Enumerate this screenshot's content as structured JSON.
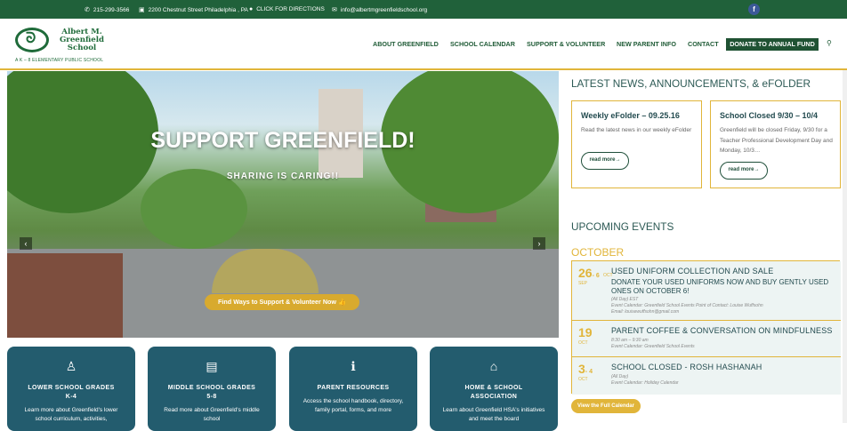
{
  "topbar": {
    "phone": "215-299-3566",
    "address": "2200 Chestnut Street Philadelphia , PA",
    "directions": "CLICK FOR DIRECTIONS",
    "email": "info@albertmgreenfieldschool.org",
    "facebook": "f"
  },
  "logo": {
    "name_line1": "Albert M.",
    "name_line2": "Greenfield",
    "name_line3": "School",
    "tagline": "A K – 8 ELEMENTARY PUBLIC SCHOOL"
  },
  "nav": {
    "items": [
      "ABOUT GREENFIELD",
      "SCHOOL CALENDAR",
      "SUPPORT & VOLUNTEER",
      "NEW PARENT INFO",
      "CONTACT"
    ],
    "donate": "DONATE TO ANNUAL FUND"
  },
  "hero": {
    "title": "SUPPORT GREENFIELD!",
    "subtitle": "SHARING IS CARING!!",
    "button": "Find Ways to Support & Volunteer Now"
  },
  "cards": [
    {
      "title_1": "LOWER SCHOOL GRADES",
      "title_2": "K-4",
      "desc": "Learn more about Greenfield's lower school curriculum, activities,"
    },
    {
      "title_1": "MIDDLE SCHOOL GRADES",
      "title_2": "5-8",
      "desc": "Read more about Greenfield's middle school"
    },
    {
      "title_1": "PARENT RESOURCES",
      "title_2": "",
      "desc": "Access the school handbook, directory, family portal, forms, and more"
    },
    {
      "title_1": "HOME & SCHOOL",
      "title_2": "ASSOCIATION",
      "desc": "Learn about Greenfield HSA's initiatives and meet the board"
    }
  ],
  "news": {
    "heading": "LATEST NEWS, ANNOUNCEMENTS, & eFOLDER",
    "items": [
      {
        "title": "Weekly eFolder – 09.25.16",
        "desc": "Read the latest news in our weekly eFolder",
        "button": "read more→"
      },
      {
        "title": "School Closed 9/30 – 10/4",
        "desc": "Greenfield will be closed Friday, 9/30 for a Teacher Professional Development Day and Monday, 10/3…",
        "button": "read more→"
      }
    ]
  },
  "events": {
    "heading": "UPCOMING EVENTS",
    "month": "OCTOBER",
    "items": [
      {
        "day": "26",
        "day_end": "- 6",
        "day_end_mon": "OCT",
        "mon": "SEP",
        "title": "USED UNIFORM COLLECTION AND SALE",
        "desc": "DONATE YOUR USED UNIFORMS NOW AND BUY GENTLY USED ONES ON OCTOBER 6!",
        "meta1": "(All Day) EST",
        "meta2": "Event Calendar: Greenfield School Events  Point of Contact: Louise Wuffsohn",
        "meta3": "Email: louisewuffsohn@gmail.com"
      },
      {
        "day": "19",
        "mon": "OCT",
        "title": "PARENT COFFEE & CONVERSATION ON MINDFULNESS",
        "meta1": "8:30 am – 9:30 am",
        "meta2": "Event Calendar: Greenfield School Events"
      },
      {
        "day": "3",
        "day_end": "- 4",
        "mon": "OCT",
        "title": "SCHOOL CLOSED - ROSH HASHANAH",
        "meta1": "(All Day)",
        "meta2": "Event Calendar: Holiday Calendar"
      }
    ],
    "full_button": "View the Full Calendar"
  }
}
